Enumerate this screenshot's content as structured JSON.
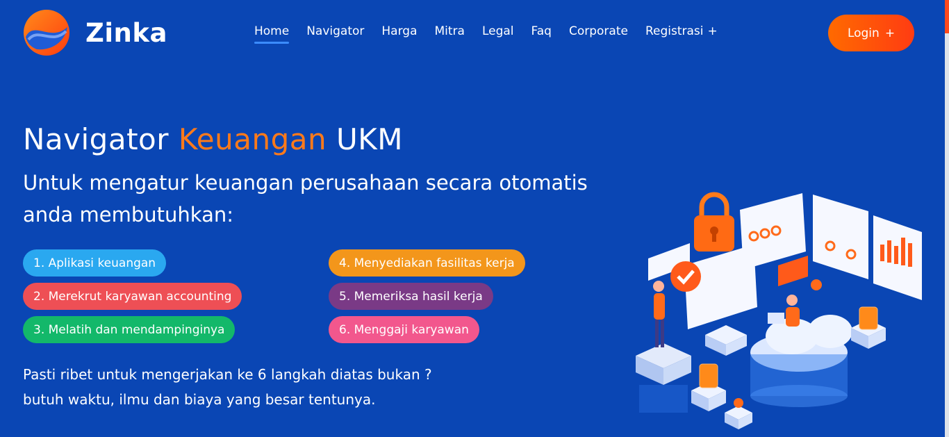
{
  "brand": {
    "name": "Zinka",
    "logo_icon": "zinka-logo-icon",
    "colors": {
      "background": "#0a46b4",
      "accent": "#ff7a1a",
      "login_button": "#ff4a1c"
    }
  },
  "nav": {
    "items": [
      "Home",
      "Navigator",
      "Harga",
      "Mitra",
      "Legal",
      "Faq",
      "Corporate",
      "Registrasi"
    ],
    "active": "Home",
    "registrasi_plus": "+"
  },
  "login": {
    "label": "Login",
    "plus": "+"
  },
  "hero": {
    "title_part1": "Navigator ",
    "title_accent": "Keuangan",
    "title_part2": " UKM",
    "subtitle": "Untuk mengatur keuangan perusahaan secara otomatis anda membutuhkan:"
  },
  "steps": [
    {
      "label": "1. Aplikasi keuangan",
      "color": "#2aa8f0"
    },
    {
      "label": "2. Merekrut karyawan accounting",
      "color": "#ee4f55"
    },
    {
      "label": "3. Melatih dan mendampinginya",
      "color": "#13b86a"
    },
    {
      "label": "4. Menyediakan fasilitas kerja",
      "color": "#f3961b"
    },
    {
      "label": "5. Memeriksa hasil kerja",
      "color": "#7a3a86"
    },
    {
      "label": "6. Menggaji karyawan",
      "color": "#f2578d"
    }
  ],
  "footer": {
    "line1": "Pasti ribet untuk mengerjakan ke 6 langkah diatas bukan ?",
    "line2": "butuh waktu, ilmu dan biaya yang besar tentunya."
  },
  "illustration_icon": "isometric-finance-dashboard-illustration"
}
